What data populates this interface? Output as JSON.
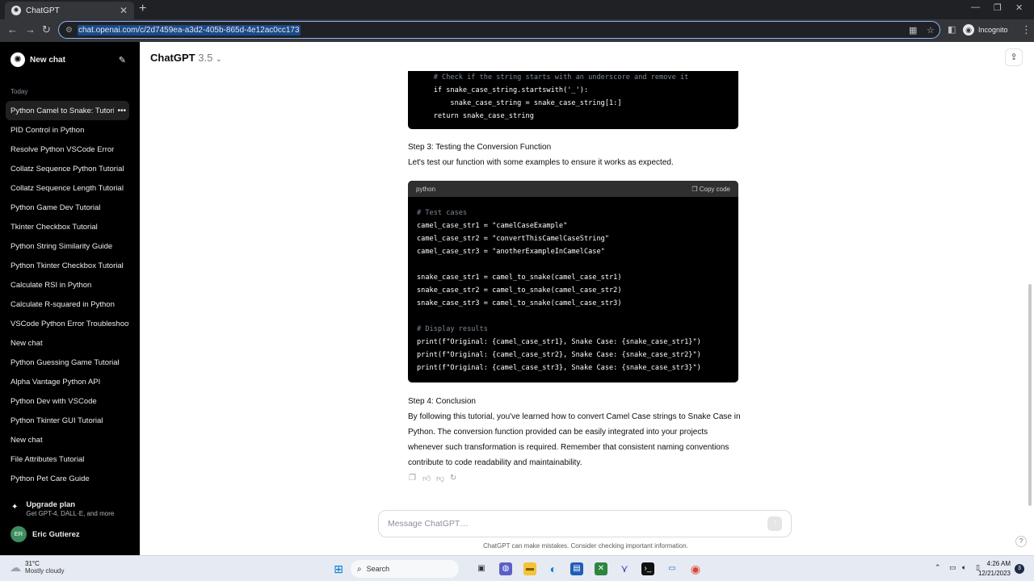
{
  "browser": {
    "tab_title": "ChatGPT",
    "favicon": "openai-icon",
    "url": "chat.openai.com/c/2d7459ea-a3d2-405b-865d-4e12ac0cc173",
    "profile_label": "Incognito"
  },
  "sidebar": {
    "new_chat_label": "New chat",
    "section_label": "Today",
    "items": [
      {
        "label": "Python Camel to Snake: Tutorial"
      },
      {
        "label": "PID Control in Python"
      },
      {
        "label": "Resolve Python VSCode Error"
      },
      {
        "label": "Collatz Sequence Python Tutorial"
      },
      {
        "label": "Collatz Sequence Length Tutorial"
      },
      {
        "label": "Python Game Dev Tutorial"
      },
      {
        "label": "Tkinter Checkbox Tutorial"
      },
      {
        "label": "Python String Similarity Guide"
      },
      {
        "label": "Python Tkinter Checkbox Tutorial"
      },
      {
        "label": "Calculate RSI in Python"
      },
      {
        "label": "Calculate R-squared in Python"
      },
      {
        "label": "VSCode Python Error Troubleshooting"
      },
      {
        "label": "New chat"
      },
      {
        "label": "Python Guessing Game Tutorial"
      },
      {
        "label": "Alpha Vantage Python API"
      },
      {
        "label": "Python Dev with VSCode"
      },
      {
        "label": "Python Tkinter GUI Tutorial"
      },
      {
        "label": "New chat"
      },
      {
        "label": "File Attributes Tutorial"
      },
      {
        "label": "Python Pet Care Guide"
      }
    ],
    "upgrade_title": "Upgrade plan",
    "upgrade_sub": "Get GPT-4, DALL·E, and more",
    "user_initials": "ER",
    "user_name": "Eric Gutierez"
  },
  "header": {
    "model_name": "ChatGPT",
    "model_version": "3.5"
  },
  "code_top": {
    "lines": [
      "    # Check if the string starts with an underscore and remove it",
      "    if snake_case_string.startswith('_'):",
      "        snake_case_string = snake_case_string[1:]",
      "    return snake_case_string"
    ]
  },
  "step3": {
    "heading": "Step 3: Testing the Conversion Function",
    "body": "Let's test our function with some examples to ensure it works as expected."
  },
  "code_block": {
    "language": "python",
    "copy_label": "Copy code",
    "lines": [
      "# Test cases",
      "camel_case_str1 = \"camelCaseExample\"",
      "camel_case_str2 = \"convertThisCamelCaseString\"",
      "camel_case_str3 = \"anotherExampleInCamelCase\"",
      "",
      "snake_case_str1 = camel_to_snake(camel_case_str1)",
      "snake_case_str2 = camel_to_snake(camel_case_str2)",
      "snake_case_str3 = camel_to_snake(camel_case_str3)",
      "",
      "# Display results",
      "print(f\"Original: {camel_case_str1}, Snake Case: {snake_case_str1}\")",
      "print(f\"Original: {camel_case_str2}, Snake Case: {snake_case_str2}\")",
      "print(f\"Original: {camel_case_str3}, Snake Case: {snake_case_str3}\")"
    ]
  },
  "step4": {
    "heading": "Step 4: Conclusion",
    "body": "By following this tutorial, you've learned how to convert Camel Case strings to Snake Case in Python. The conversion function provided can be easily integrated into your projects whenever such transformation is required. Remember that consistent naming conventions contribute to code readability and maintainability."
  },
  "composer": {
    "placeholder": "Message ChatGPT…",
    "disclaimer": "ChatGPT can make mistakes. Consider checking important information."
  },
  "taskbar": {
    "weather_temp": "31°C",
    "weather_condition": "Mostly cloudy",
    "search_label": "Search",
    "time": "4:26 AM",
    "date": "12/21/2023",
    "notification_count": "3"
  }
}
